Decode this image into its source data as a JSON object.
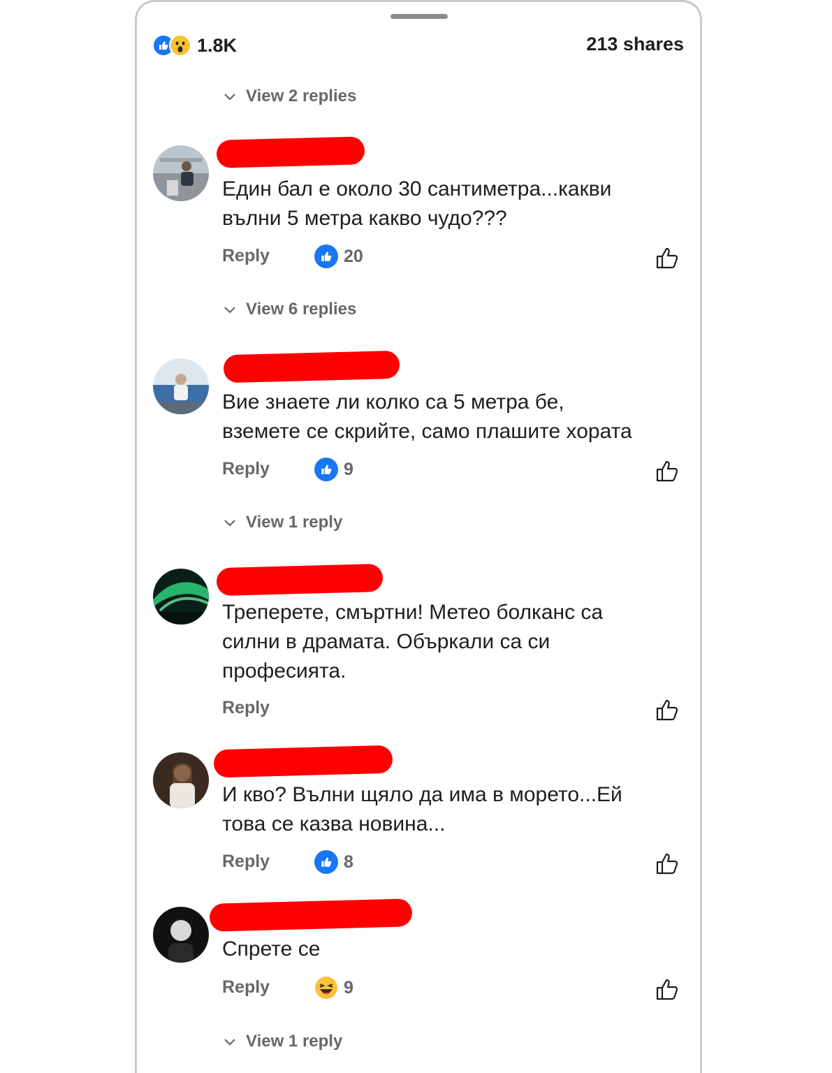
{
  "header": {
    "reaction_count": "1.8K",
    "reaction_icons": [
      "like-icon",
      "wow-icon"
    ],
    "shares": "213 shares"
  },
  "top_view_replies": "View 2 replies",
  "comments": [
    {
      "text_line1": "Един бал е около 30 сантиметра...какви",
      "text_line2": "вълни 5 метра какво чудо???",
      "reply_label": "Reply",
      "reaction_icon": "like-icon",
      "reaction_count": "20",
      "view_replies": "View 6 replies"
    },
    {
      "text_line1": "Вие знаете ли колко са 5 метра бе,",
      "text_line2": "вземете се скрийте, само плашите хората",
      "reply_label": "Reply",
      "reaction_icon": "like-icon",
      "reaction_count": "9",
      "view_replies": "View 1 reply"
    },
    {
      "text_line1": "Треперете, смъртни! Метео болканс са",
      "text_line2": "силни в драмата. Объркали са си",
      "text_line3": "професията.",
      "reply_label": "Reply"
    },
    {
      "text_line1": "И кво? Вълни щяло да има в морето...Ей",
      "text_line2": "това се казва новина...",
      "reply_label": "Reply",
      "reaction_icon": "like-icon",
      "reaction_count": "8"
    },
    {
      "text_line1": "Спрете се",
      "reply_label": "Reply",
      "reaction_icon": "haha-icon",
      "reaction_count": "9",
      "view_replies": "View 1 reply"
    }
  ],
  "colors": {
    "like_blue": "#1877f2",
    "redaction_red": "#ff0000",
    "secondary_text": "#65676b",
    "primary_text": "#1c1e21"
  }
}
